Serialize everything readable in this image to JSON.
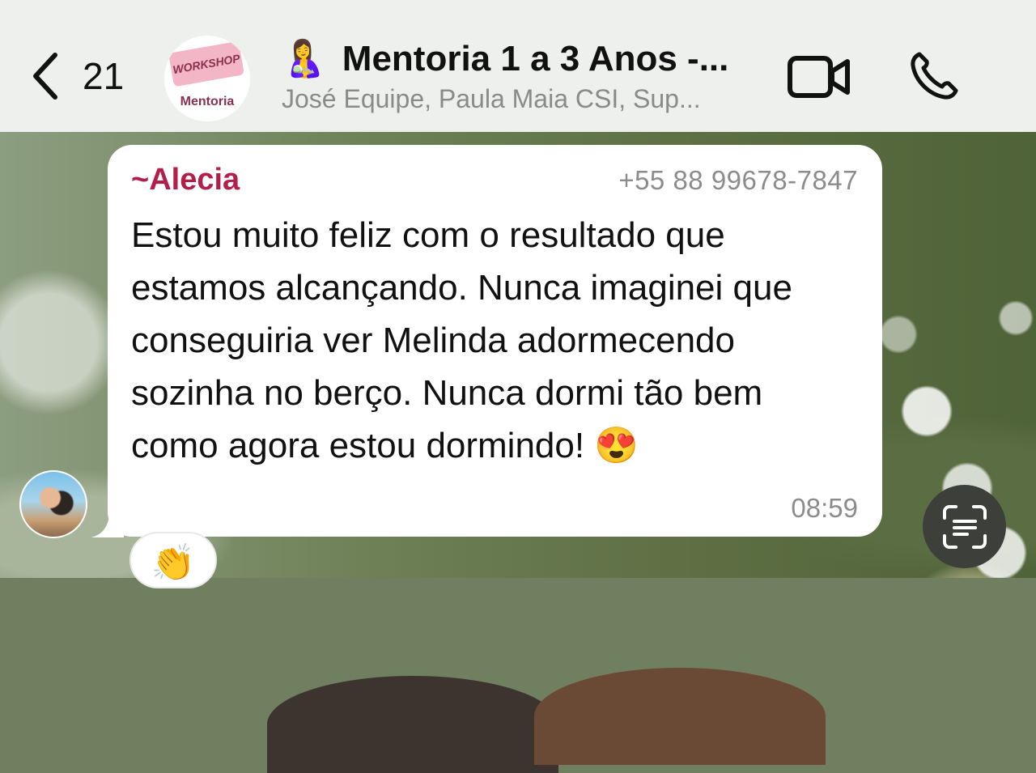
{
  "header": {
    "back_count": "21",
    "group_avatar": {
      "banner_text": "WORKSHOP",
      "label": "Mentoria"
    },
    "title_emoji": "🤱",
    "title": "Mentoria 1 a 3 Anos -...",
    "subtitle": "José Equipe, Paula Maia CSI, Sup...",
    "icons": [
      "chevron-left-icon",
      "video-call-icon",
      "phone-icon"
    ]
  },
  "message": {
    "sender_prefix": "~",
    "sender_name": "Alecia",
    "sender_phone": "+55 88 99678-7847",
    "text": "Estou muito feliz com o resultado que estamos alcançando. Nunca imaginei que conseguiria ver Melinda adormecendo sozinha no berço. Nunca dormi tão bem como agora estou dormindo! 😍",
    "time": "08:59",
    "reaction": "👏"
  },
  "colors": {
    "sender_name": "#b21f4a",
    "header_bg": "#eef0ed",
    "bubble_bg": "#ffffff"
  }
}
